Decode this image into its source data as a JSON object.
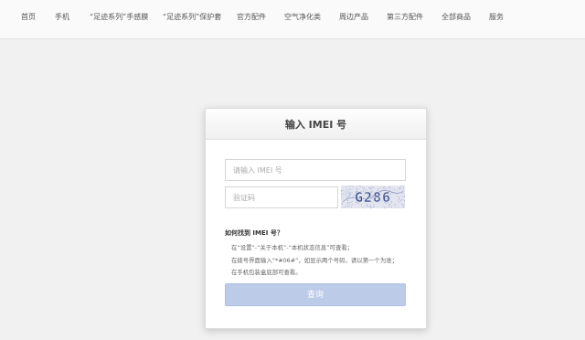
{
  "nav": {
    "items": [
      "首页",
      "手机",
      "“足迹系列”手感膜",
      "“足迹系列”保护套",
      "官方配件",
      "空气净化类",
      "周边产品",
      "第三方配件",
      "全部商品",
      "服务"
    ]
  },
  "form": {
    "title": "输入 IMEI 号",
    "imei_placeholder": "请输入 IMEI 号",
    "captcha_placeholder": "验证码",
    "captcha_text": "G286",
    "help_title": "如何找到 IMEI 号？",
    "help_lines": [
      "在“设置”-“关于本机”-“本机状态信息”可查看；",
      "在拨号界面输入“*#06#”，如显示两个号码，请以第一个为准；",
      "在手机包装盒底部可查看。"
    ],
    "submit_label": "查询"
  }
}
